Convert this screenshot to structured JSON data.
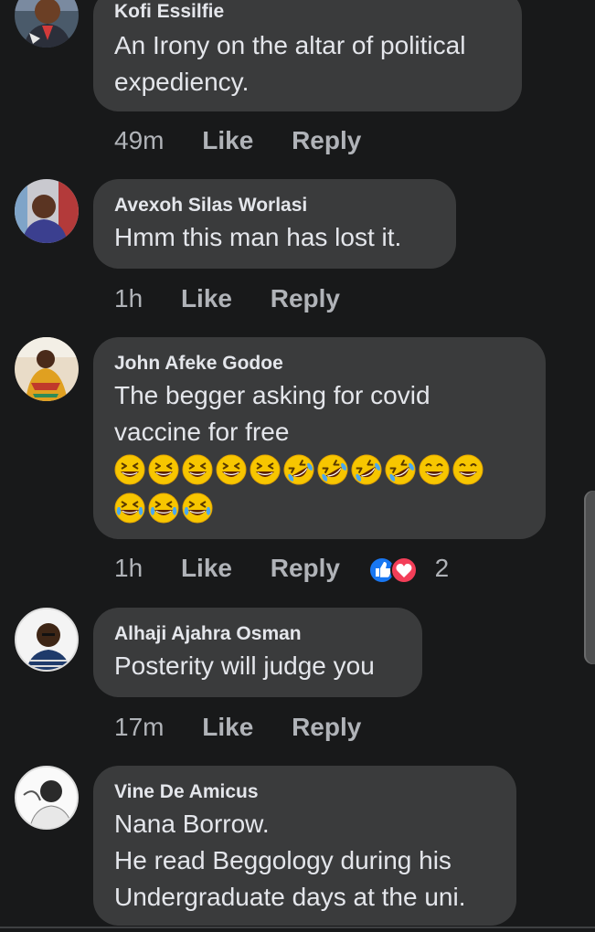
{
  "comments": [
    {
      "author": "Kofi Essilfie",
      "lines": [
        "An Irony on the altar of political",
        "expediency."
      ],
      "time": "49m",
      "like_label": "Like",
      "reply_label": "Reply"
    },
    {
      "author": "Avexoh Silas Worlasi",
      "lines": [
        "Hmm this man has lost it."
      ],
      "time": "1h",
      "like_label": "Like",
      "reply_label": "Reply"
    },
    {
      "author": "John Afeke Godoe",
      "lines": [
        "The begger asking for covid",
        "vaccine for free"
      ],
      "emoji_rows": [
        [
          "grinning-squint",
          "grinning-squint",
          "grinning-squint",
          "grinning-squint",
          "grinning-squint",
          "rofl",
          "rofl",
          "rofl",
          "rofl",
          "beaming",
          "beaming"
        ],
        [
          "tears-of-joy",
          "tears-of-joy",
          "tears-of-joy"
        ]
      ],
      "time": "1h",
      "like_label": "Like",
      "reply_label": "Reply",
      "reactions": [
        "like",
        "love"
      ],
      "reaction_count": "2"
    },
    {
      "author": "Alhaji Ajahra Osman",
      "lines": [
        "Posterity will judge you"
      ],
      "time": "17m",
      "like_label": "Like",
      "reply_label": "Reply"
    },
    {
      "author": "Vine De Amicus",
      "lines": [
        "Nana Borrow.",
        "He read Beggology during his",
        "Undergraduate days at the uni."
      ]
    }
  ],
  "colors": {
    "background": "#18191a",
    "bubble": "#3a3b3c",
    "text": "#e4e6eb",
    "secondary_text": "#b0b3b8",
    "like_blue": "#1877f2",
    "love_red": "#f33e58"
  }
}
